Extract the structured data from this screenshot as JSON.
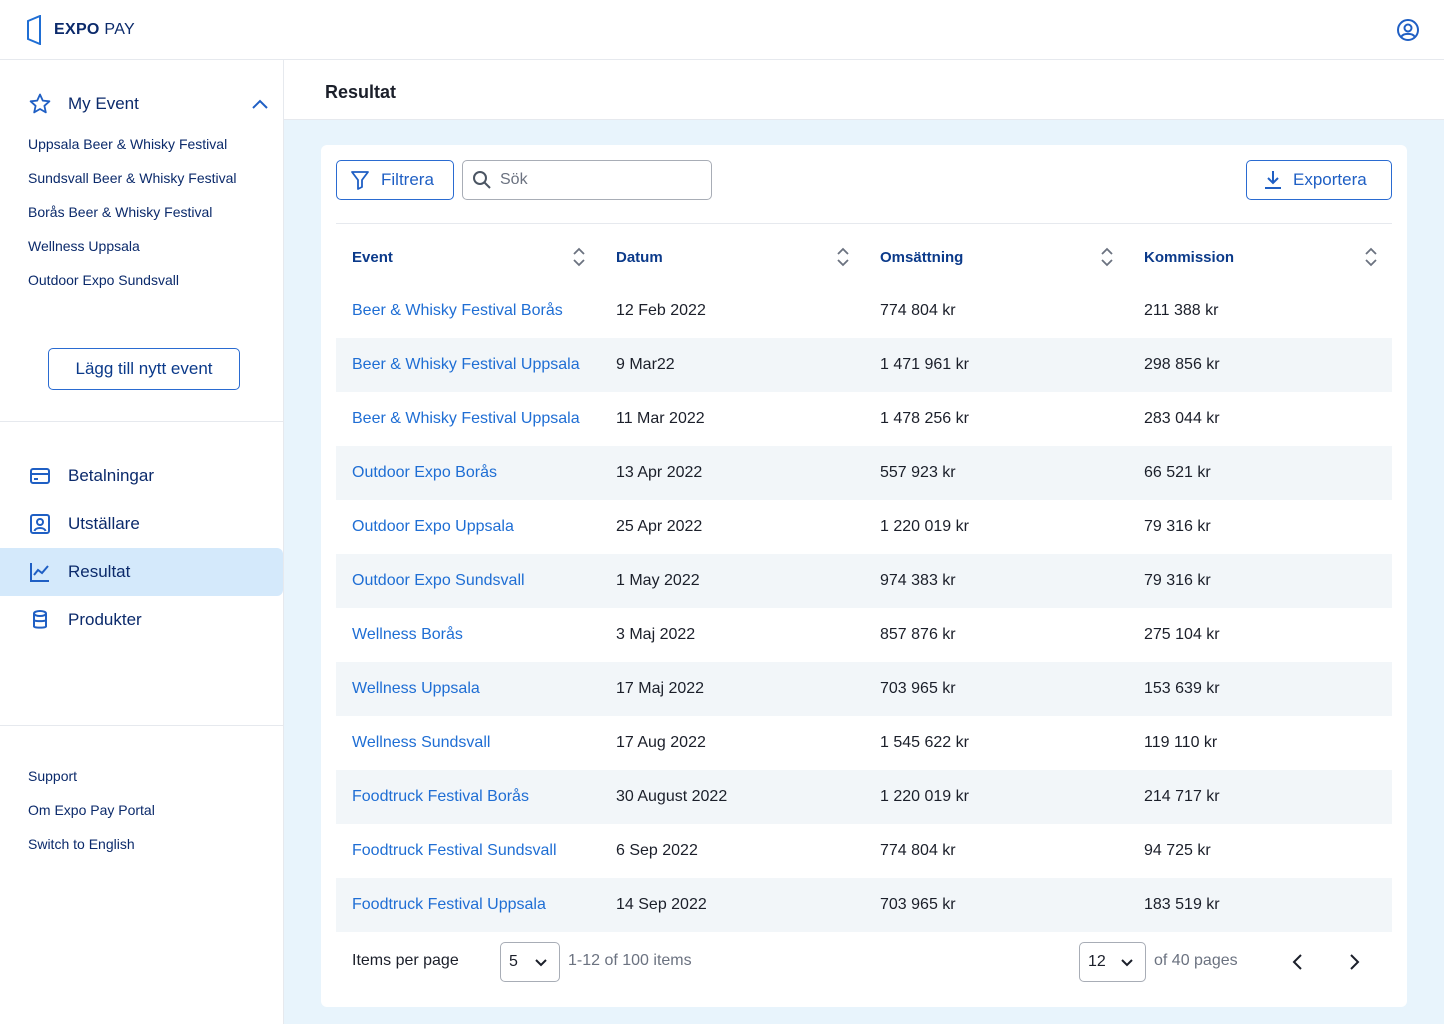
{
  "app": {
    "brand_bold": "EXPO",
    "brand_light": " PAY"
  },
  "sidebar": {
    "my_event_label": "My Event",
    "events": [
      "Uppsala Beer & Whisky Festival",
      "Sundsvall Beer & Whisky Festival",
      "Borås Beer & Whisky Festival",
      "Wellness Uppsala",
      "Outdoor Expo Sundsvall"
    ],
    "add_event_label": "Lägg till nytt event",
    "nav": [
      {
        "label": "Betalningar",
        "icon": "credit-card-icon"
      },
      {
        "label": "Utställare",
        "icon": "exhibitor-icon"
      },
      {
        "label": "Resultat",
        "icon": "chart-line-icon",
        "active": true
      },
      {
        "label": "Produkter",
        "icon": "database-icon"
      }
    ],
    "footer": [
      "Support",
      "Om Expo Pay Portal",
      "Switch to English"
    ]
  },
  "main": {
    "title": "Resultat",
    "toolbar": {
      "filter_label": "Filtrera",
      "search_placeholder": "Sök",
      "export_label": "Exportera"
    },
    "table": {
      "columns": [
        "Event",
        "Datum",
        "Omsättning",
        "Kommission"
      ],
      "rows": [
        [
          "Beer & Whisky Festival Borås",
          "12 Feb 2022",
          "774 804 kr",
          "211 388 kr"
        ],
        [
          "Beer & Whisky Festival Uppsala",
          "9 Mar22",
          "1 471 961 kr",
          "298 856 kr"
        ],
        [
          "Beer & Whisky Festival Uppsala",
          "11 Mar 2022",
          "1 478 256 kr",
          "283 044 kr"
        ],
        [
          "Outdoor Expo Borås",
          "13 Apr 2022",
          "557 923 kr",
          "66 521 kr"
        ],
        [
          "Outdoor Expo Uppsala",
          "25 Apr 2022",
          "1 220 019 kr",
          "79 316 kr"
        ],
        [
          "Outdoor Expo Sundsvall",
          "1 May 2022",
          "974 383 kr",
          "79 316 kr"
        ],
        [
          "Wellness Borås",
          "3 Maj 2022",
          "857 876 kr",
          "275 104 kr"
        ],
        [
          "Wellness Uppsala",
          "17 Maj 2022",
          "703 965 kr",
          "153 639 kr"
        ],
        [
          "Wellness Sundsvall",
          "17 Aug 2022",
          "1 545 622 kr",
          "119 110 kr"
        ],
        [
          "Foodtruck Festival Borås",
          "30 August 2022",
          "1 220 019 kr",
          "214 717 kr"
        ],
        [
          "Foodtruck Festival Sundsvall",
          "6 Sep 2022",
          "774 804 kr",
          "94 725 kr"
        ],
        [
          "Foodtruck Festival Uppsala",
          "14 Sep 2022",
          "703 965 kr",
          "183 519 kr"
        ]
      ]
    },
    "pagination": {
      "items_per_page_label": "Items per page",
      "items_per_page_value": "5",
      "range_text": "1-12 of 100 items",
      "page_value": "12",
      "pages_text": "of 40 pages"
    }
  },
  "colors": {
    "accent": "#1f6ed4",
    "navy": "#0b2a6b",
    "active_bg": "#d4e9fb",
    "content_bg": "#e8f4fc",
    "row_alt": "#f2f6f9"
  }
}
